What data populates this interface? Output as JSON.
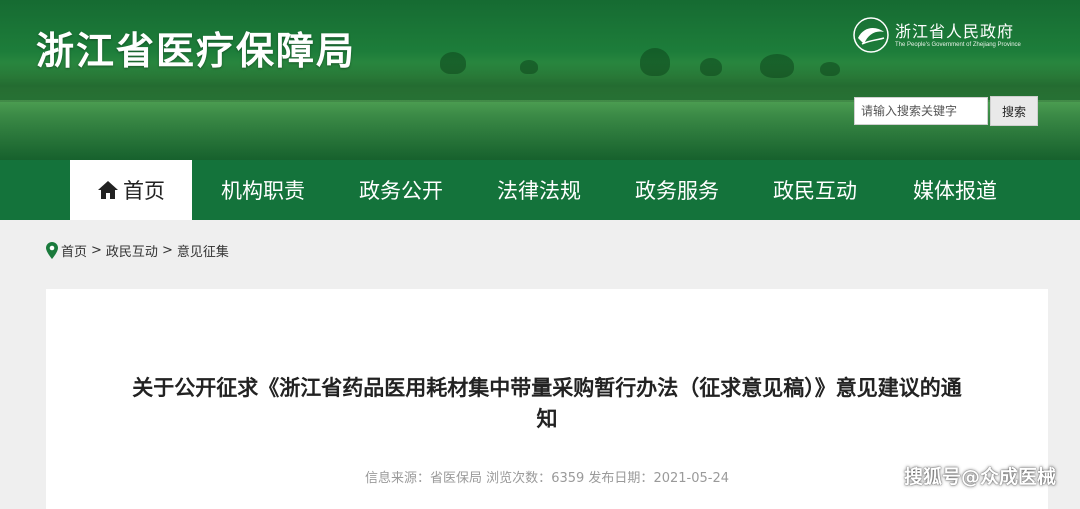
{
  "header": {
    "site_title": "浙江省医疗保障局",
    "gov_name": "浙江省人民政府",
    "gov_name_en": "The People's Government of Zhejiang Province",
    "search_placeholder": "请输入搜索关键字",
    "search_button": "搜索"
  },
  "nav": {
    "items": [
      {
        "label": "首页",
        "active": true,
        "icon": "home-icon"
      },
      {
        "label": "机构职责"
      },
      {
        "label": "政务公开"
      },
      {
        "label": "法律法规"
      },
      {
        "label": "政务服务"
      },
      {
        "label": "政民互动"
      },
      {
        "label": "媒体报道"
      }
    ]
  },
  "breadcrumb": {
    "icon": "location-pin-icon",
    "items": [
      "首页",
      "政民互动",
      "意见征集"
    ],
    "separator": ">"
  },
  "article": {
    "title": "关于公开征求《浙江省药品医用耗材集中带量采购暂行办法（征求意见稿）》意见建议的通知",
    "meta": {
      "source_label": "信息来源：",
      "source": "省医保局",
      "views_label": "浏览次数：",
      "views": "6359",
      "date_label": "发布日期：",
      "date": "2021-05-24"
    }
  },
  "watermark": "搜狐号@众成医械",
  "colors": {
    "nav_bg": "#14733b",
    "banner_green": "#1d7d3a",
    "page_bg": "#efefef"
  }
}
